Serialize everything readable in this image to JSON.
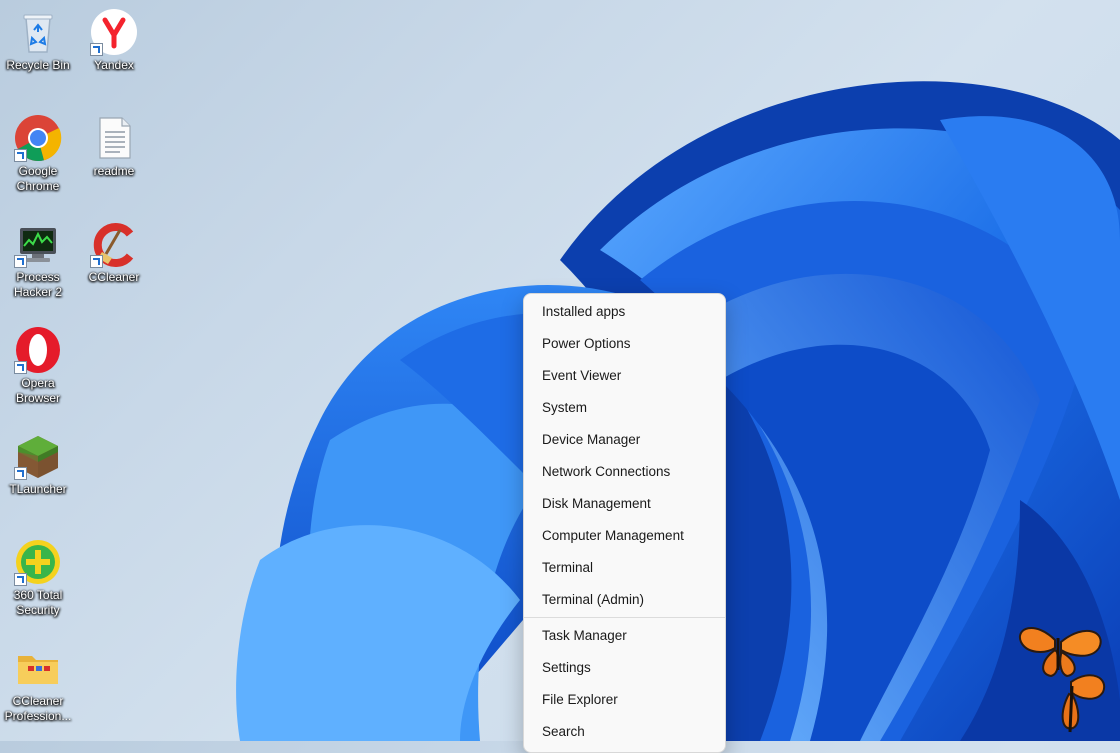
{
  "desktop": {
    "icons": [
      {
        "label": "Recycle Bin",
        "icon": "recycle-bin-icon"
      },
      {
        "label": "Yandex",
        "icon": "yandex-icon"
      },
      {
        "label": "Google Chrome",
        "icon": "chrome-icon"
      },
      {
        "label": "readme",
        "icon": "text-document-icon"
      },
      {
        "label": "Process Hacker 2",
        "icon": "process-hacker-icon"
      },
      {
        "label": "CCleaner",
        "icon": "ccleaner-icon"
      },
      {
        "label": "Opera Browser",
        "icon": "opera-icon"
      },
      {
        "label": "TLauncher",
        "icon": "tlauncher-icon"
      },
      {
        "label": "360 Total Security",
        "icon": "360-security-icon"
      },
      {
        "label": "CCleaner Profession...",
        "icon": "folder-icon"
      }
    ]
  },
  "context_menu": {
    "group1": [
      "Installed apps",
      "Power Options",
      "Event Viewer",
      "System",
      "Device Manager",
      "Network Connections",
      "Disk Management",
      "Computer Management",
      "Terminal",
      "Terminal (Admin)"
    ],
    "group2": [
      "Task Manager",
      "Settings",
      "File Explorer",
      "Search"
    ]
  },
  "colors": {
    "accent": "#1f6fd0",
    "bloom_dark": "#0a3fb8",
    "bloom_light": "#3a8ff0",
    "menu_background": "#f9f9f9"
  }
}
